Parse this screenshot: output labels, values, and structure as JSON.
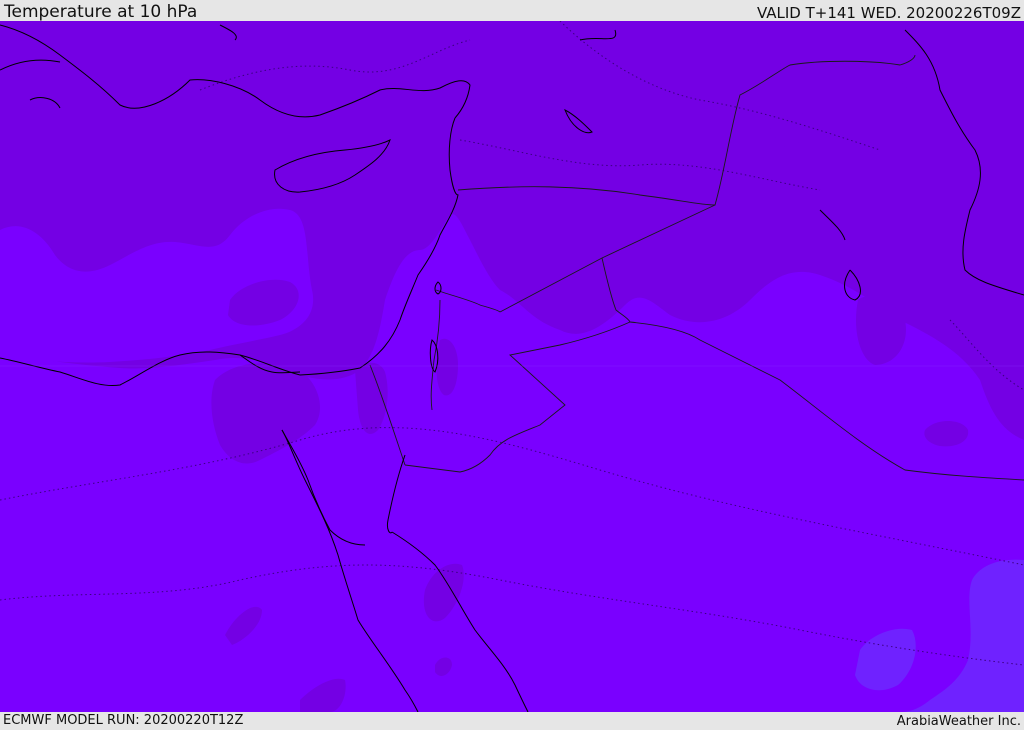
{
  "header": {
    "title": "Temperature at 10 hPa",
    "valid": "VALID T+141 WED. 20200226T09Z"
  },
  "footer": {
    "model_run": "ECMWF MODEL RUN: 20200220T12Z",
    "credit": "ArabiaWeather Inc."
  },
  "colors": {
    "base": "#7a00ff",
    "cool_zone": "#7400e4",
    "warm_patch": "#6f22ff",
    "coastline": "#000000",
    "border": "#1a1a1a"
  }
}
